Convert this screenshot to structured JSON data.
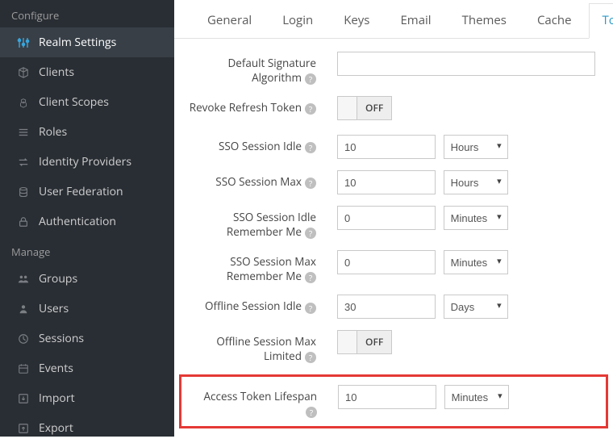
{
  "sidebar": {
    "sections": {
      "configure": {
        "title": "Configure",
        "items": [
          {
            "label": "Realm Settings"
          },
          {
            "label": "Clients"
          },
          {
            "label": "Client Scopes"
          },
          {
            "label": "Roles"
          },
          {
            "label": "Identity Providers"
          },
          {
            "label": "User Federation"
          },
          {
            "label": "Authentication"
          }
        ]
      },
      "manage": {
        "title": "Manage",
        "items": [
          {
            "label": "Groups"
          },
          {
            "label": "Users"
          },
          {
            "label": "Sessions"
          },
          {
            "label": "Events"
          },
          {
            "label": "Import"
          },
          {
            "label": "Export"
          }
        ]
      }
    }
  },
  "tabs": {
    "general": "General",
    "login": "Login",
    "keys": "Keys",
    "email": "Email",
    "themes": "Themes",
    "cache": "Cache",
    "tokens": "Tokens"
  },
  "form": {
    "defaultSigAlg": {
      "label": "Default Signature Algorithm",
      "value": ""
    },
    "revokeRefresh": {
      "label": "Revoke Refresh Token",
      "state": "OFF"
    },
    "ssoIdle": {
      "label": "SSO Session Idle",
      "value": "10",
      "unit": "Hours"
    },
    "ssoMax": {
      "label": "SSO Session Max",
      "value": "10",
      "unit": "Hours"
    },
    "ssoIdleRM": {
      "label": "SSO Session Idle Remember Me",
      "value": "0",
      "unit": "Minutes"
    },
    "ssoMaxRM": {
      "label": "SSO Session Max Remember Me",
      "value": "0",
      "unit": "Minutes"
    },
    "offlineIdle": {
      "label": "Offline Session Idle",
      "value": "30",
      "unit": "Days"
    },
    "offlineMaxLimited": {
      "label": "Offline Session Max Limited",
      "state": "OFF"
    },
    "accessTokenLifespan": {
      "label": "Access Token Lifespan",
      "value": "10",
      "unit": "Minutes"
    }
  }
}
